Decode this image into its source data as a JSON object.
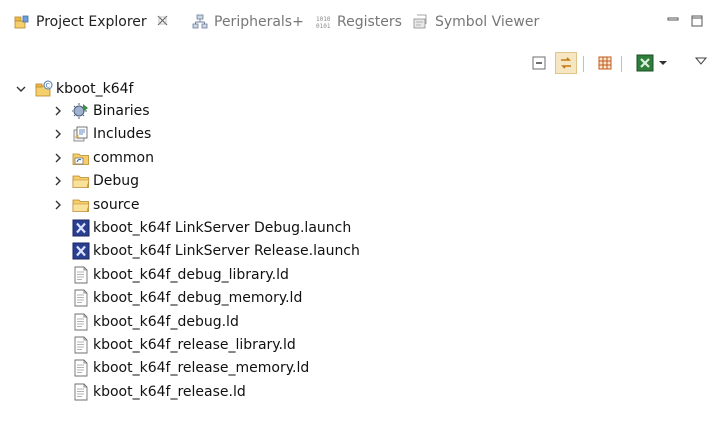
{
  "tabs": [
    {
      "label": "Project Explorer",
      "icon": "project-explorer-icon",
      "active": true,
      "close_glyph": "⌕"
    },
    {
      "label": "Peripherals+",
      "icon": "peripherals-icon",
      "active": false
    },
    {
      "label": "Registers",
      "icon": "registers-icon",
      "active": false
    },
    {
      "label": "Symbol Viewer",
      "icon": "symbol-viewer-icon",
      "active": false
    }
  ],
  "window_controls": {
    "minimize_icon": "minimize-icon",
    "maximize_icon": "maximize-icon"
  },
  "toolbar": {
    "collapse_all": "collapse-all-icon",
    "link_with_editor": "link-with-editor-icon",
    "filter": "filter-icon",
    "launch": "launch-config-icon",
    "launch_dropdown": "dropdown-arrow-icon",
    "view_menu": "view-menu-icon"
  },
  "tree": {
    "project": {
      "label": "kboot_k64f",
      "icon": "c-project-icon",
      "expanded": true
    },
    "items": [
      {
        "label": "Binaries",
        "icon": "binaries-icon",
        "expandable": true
      },
      {
        "label": "Includes",
        "icon": "includes-icon",
        "expandable": true
      },
      {
        "label": "common",
        "icon": "linked-folder-icon",
        "expandable": true
      },
      {
        "label": "Debug",
        "icon": "folder-icon",
        "expandable": true
      },
      {
        "label": "source",
        "icon": "folder-icon",
        "expandable": true
      },
      {
        "label": "kboot_k64f LinkServer Debug.launch",
        "icon": "launch-file-icon",
        "expandable": false
      },
      {
        "label": "kboot_k64f LinkServer Release.launch",
        "icon": "launch-file-icon",
        "expandable": false
      },
      {
        "label": "kboot_k64f_debug_library.ld",
        "icon": "text-file-icon",
        "expandable": false
      },
      {
        "label": "kboot_k64f_debug_memory.ld",
        "icon": "text-file-icon",
        "expandable": false
      },
      {
        "label": "kboot_k64f_debug.ld",
        "icon": "text-file-icon",
        "expandable": false
      },
      {
        "label": "kboot_k64f_release_library.ld",
        "icon": "text-file-icon",
        "expandable": false
      },
      {
        "label": "kboot_k64f_release_memory.ld",
        "icon": "text-file-icon",
        "expandable": false
      },
      {
        "label": "kboot_k64f_release.ld",
        "icon": "text-file-icon",
        "expandable": false
      }
    ]
  },
  "colors": {
    "folder": "#e9b949",
    "launch": "#2b3f8f",
    "accent": "#f7e6c2"
  }
}
